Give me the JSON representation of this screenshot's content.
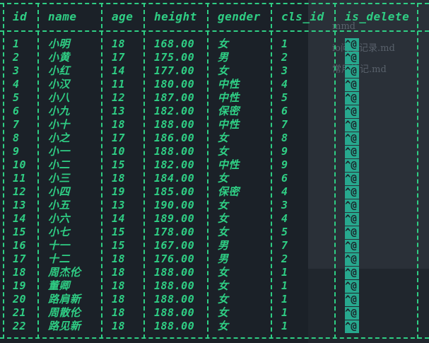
{
  "ghost_files": [
    "mmd",
    "io问题记录.md",
    "常用笔记.md"
  ],
  "headers": [
    "id",
    "name",
    "age",
    "height",
    "gender",
    "cls_id",
    "is_delete"
  ],
  "rows": [
    [
      "1",
      "小明",
      "18",
      "168.00",
      "女",
      "1",
      "^@"
    ],
    [
      "2",
      "小黄",
      "17",
      "175.00",
      "男",
      "2",
      "^@"
    ],
    [
      "3",
      "小红",
      "14",
      "177.00",
      "女",
      "3",
      "^@"
    ],
    [
      "4",
      "小汉",
      "11",
      "180.00",
      "中性",
      "4",
      "^@"
    ],
    [
      "5",
      "小八",
      "12",
      "187.00",
      "中性",
      "5",
      "^@"
    ],
    [
      "6",
      "小九",
      "13",
      "182.00",
      "保密",
      "6",
      "^@"
    ],
    [
      "7",
      "小十",
      "18",
      "188.00",
      "中性",
      "7",
      "^@"
    ],
    [
      "8",
      "小之",
      "17",
      "186.00",
      "女",
      "8",
      "^@"
    ],
    [
      "9",
      "小一",
      "10",
      "188.00",
      "女",
      "9",
      "^@"
    ],
    [
      "10",
      "小二",
      "15",
      "182.00",
      "中性",
      "9",
      "^@"
    ],
    [
      "11",
      "小三",
      "18",
      "184.00",
      "女",
      "6",
      "^@"
    ],
    [
      "12",
      "小四",
      "19",
      "185.00",
      "保密",
      "4",
      "^@"
    ],
    [
      "13",
      "小五",
      "13",
      "190.00",
      "女",
      "3",
      "^@"
    ],
    [
      "14",
      "小六",
      "14",
      "189.00",
      "女",
      "4",
      "^@"
    ],
    [
      "15",
      "小七",
      "15",
      "178.00",
      "女",
      "5",
      "^@"
    ],
    [
      "16",
      "十一",
      "15",
      "167.00",
      "男",
      "7",
      "^@"
    ],
    [
      "17",
      "十二",
      "18",
      "176.00",
      "男",
      "2",
      "^@"
    ],
    [
      "18",
      "周杰伦",
      "18",
      "188.00",
      "女",
      "1",
      "^@"
    ],
    [
      "19",
      "董卿",
      "18",
      "188.00",
      "女",
      "1",
      "^@"
    ],
    [
      "20",
      "路肩新",
      "18",
      "188.00",
      "女",
      "1",
      "^@"
    ],
    [
      "21",
      "周散伦",
      "18",
      "188.00",
      "女",
      "1",
      "^@"
    ],
    [
      "22",
      "路见新",
      "18",
      "188.00",
      "女",
      "1",
      "^@"
    ]
  ],
  "colors": {
    "background": "#1b2128",
    "text": "#2fce84",
    "highlight": "#27a88e"
  }
}
